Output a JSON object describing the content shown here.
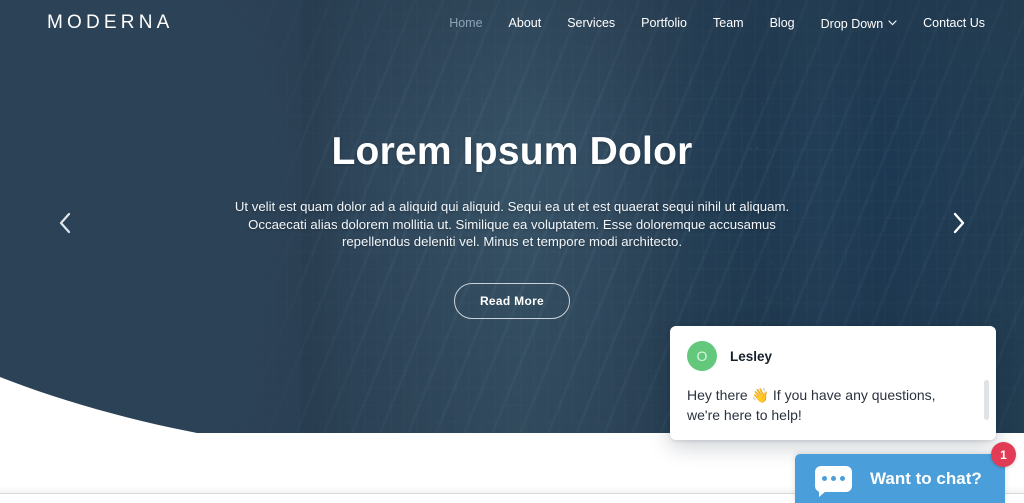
{
  "site": {
    "logo": "MODERNA",
    "nav": [
      {
        "label": "Home",
        "active": true
      },
      {
        "label": "About",
        "active": false
      },
      {
        "label": "Services",
        "active": false
      },
      {
        "label": "Portfolio",
        "active": false
      },
      {
        "label": "Team",
        "active": false
      },
      {
        "label": "Blog",
        "active": false
      },
      {
        "label": "Drop Down",
        "active": false,
        "has_dropdown": true
      },
      {
        "label": "Contact Us",
        "active": false
      }
    ]
  },
  "hero": {
    "title": "Lorem Ipsum Dolor",
    "paragraph": "Ut velit est quam dolor ad a aliquid qui aliquid. Sequi ea ut et est quaerat sequi nihil ut aliquam. Occaecati alias dolorem mollitia ut. Similique ea voluptatem. Esse doloremque accusamus repellendus deleniti vel. Minus et tempore modi architecto.",
    "cta_label": "Read More",
    "prev_icon": "chevron-left-icon",
    "next_icon": "chevron-right-icon"
  },
  "chat": {
    "avatar_initial": "O",
    "agent_name": "Lesley",
    "message": "Hey there 👋  If you have any questions, we're here to help!",
    "launcher_label": "Want to chat?",
    "badge_count": "1",
    "bubble_icon": "chat-bubble-icon"
  },
  "colors": {
    "hero_navy": "#2c4257",
    "wave_band": "#d5e0ea",
    "avatar_green": "#63c87c",
    "launcher_blue": "#4a9fda",
    "badge_red": "#e23b55",
    "nav_active": "#8ea4b6"
  }
}
